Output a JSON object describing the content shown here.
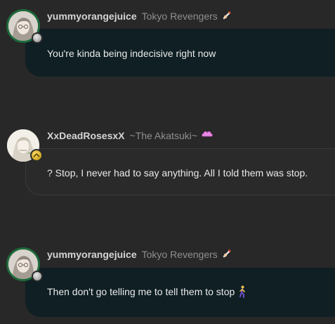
{
  "messages": [
    {
      "username": "yummyorangejuice",
      "group": "Tokyo Revengers",
      "group_icon": "tokyo-revengers-icon",
      "text": "You're kinda being indecisive right now",
      "rank": "silver",
      "bubble_style": "dark"
    },
    {
      "username": "XxDeadRosesxX",
      "group": "~The Akatsuki~",
      "group_icon": "akatsuki-cloud-icon",
      "text": "? Stop, I never had to say anything. All I told them was stop.",
      "rank": "gold",
      "bubble_style": "outline"
    },
    {
      "username": "yummyorangejuice",
      "group": "Tokyo Revengers",
      "group_icon": "tokyo-revengers-icon",
      "text": "Then don't go telling me to tell them to stop",
      "trailing_emoji": "walking-person-icon",
      "rank": "silver",
      "bubble_style": "dark"
    }
  ],
  "colors": {
    "background": "#282828",
    "avatar_ring": "#1f6a3c",
    "bubble_dark": "#0f1f24",
    "username": "#d5d5d5",
    "group": "#8f8f8f",
    "text": "#eaeaea"
  }
}
